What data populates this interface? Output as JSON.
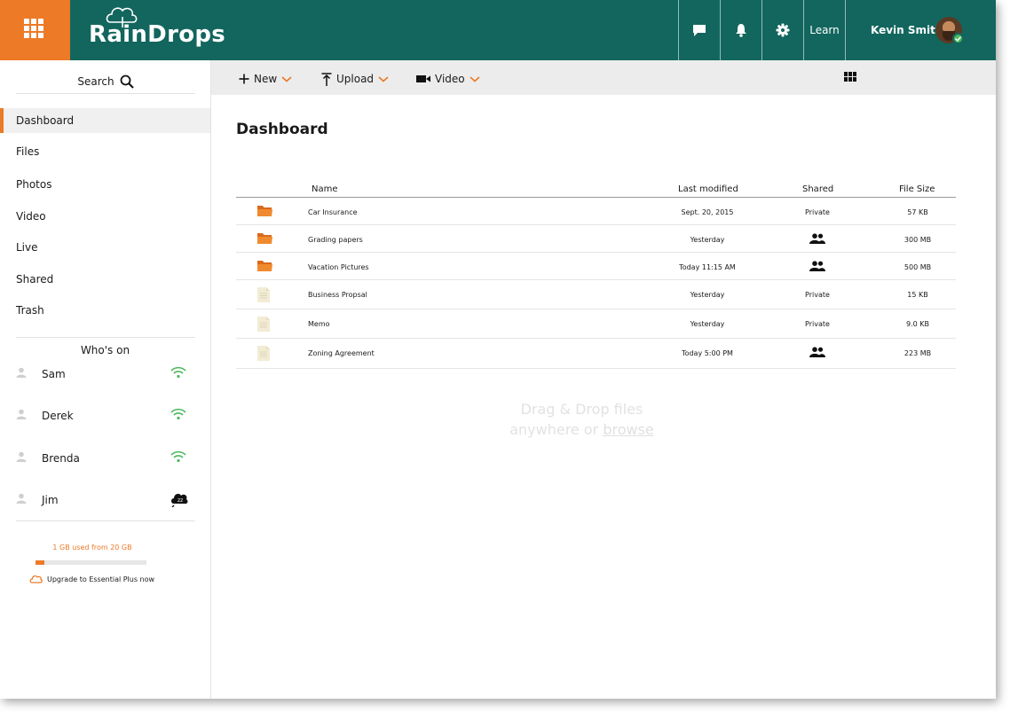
{
  "app": {
    "name": "RainDrops"
  },
  "header": {
    "learn_label": "Learn",
    "user_name": "Kevin Smith"
  },
  "sidebar": {
    "search_label": "Search",
    "nav": [
      {
        "label": "Dashboard",
        "active": true
      },
      {
        "label": "Files",
        "active": false
      },
      {
        "label": "Photos",
        "active": false
      },
      {
        "label": "Video",
        "active": false
      },
      {
        "label": "Live",
        "active": false
      },
      {
        "label": "Shared",
        "active": false
      },
      {
        "label": "Trash",
        "active": false
      }
    ],
    "whos_on_title": "Who's on",
    "people": [
      {
        "name": "Sam",
        "status": "online"
      },
      {
        "name": "Derek",
        "status": "online"
      },
      {
        "name": "Brenda",
        "status": "online"
      },
      {
        "name": "Jim",
        "status": "away"
      }
    ],
    "storage": {
      "text": "1 GB used from 20 GB",
      "used_fraction": 0.05
    },
    "upgrade_label": "Upgrade to Essential Plus now"
  },
  "toolbar": {
    "new_label": "New",
    "upload_label": "Upload",
    "video_label": "Video"
  },
  "main": {
    "title": "Dashboard",
    "columns": {
      "name": "Name",
      "modified": "Last modified",
      "shared": "Shared",
      "size": "File Size"
    },
    "rows": [
      {
        "type": "folder",
        "name": "Car Insurance",
        "modified": "Sept. 20, 2015",
        "shared": "Private",
        "size": "57 KB"
      },
      {
        "type": "folder",
        "name": "Grading papers",
        "modified": "Yesterday",
        "shared": "",
        "size": "300 MB"
      },
      {
        "type": "folder",
        "name": "Vacation Pictures",
        "modified": "Today 11:15 AM",
        "shared": "",
        "size": "500 MB"
      },
      {
        "type": "document",
        "name": "Business Propsal",
        "modified": "Yesterday",
        "shared": "Private",
        "size": "15 KB"
      },
      {
        "type": "document",
        "name": "Memo",
        "modified": "Yesterday",
        "shared": "Private",
        "size": "9.0 KB"
      },
      {
        "type": "document",
        "name": "Zoning Agreement",
        "modified": "Today 5:00 PM",
        "shared": "",
        "size": "223 MB"
      }
    ],
    "dropzone": {
      "line1": "Drag & Drop files",
      "line2_prefix": "anywhere or",
      "browse_label": "browse"
    }
  },
  "colors": {
    "header": "#12665e",
    "accent": "#ec7a26",
    "online": "#4cb85c"
  }
}
